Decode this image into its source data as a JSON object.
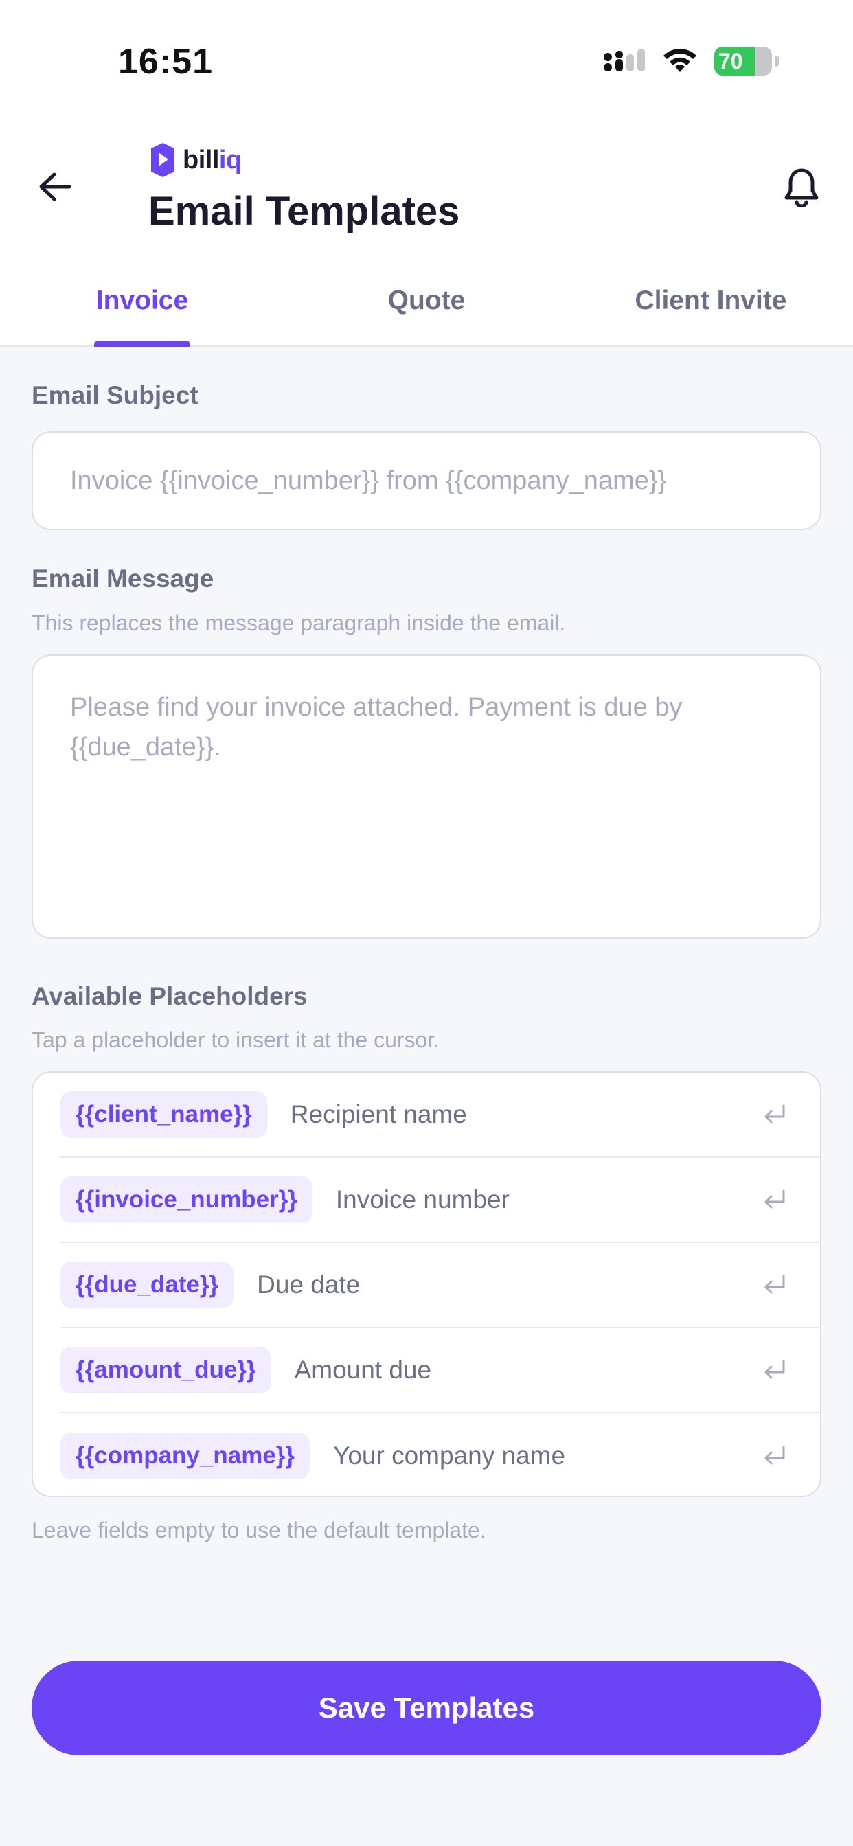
{
  "status_bar": {
    "time": "16:51",
    "battery_level": "70",
    "battery_fraction": 0.7,
    "icons": [
      "signal-icon",
      "wifi-icon",
      "battery-icon"
    ]
  },
  "header": {
    "brand_prefix": "bill",
    "brand_suffix": "iq",
    "title": "Email Templates",
    "back_icon": "arrow-left-icon",
    "bell_icon": "bell-icon"
  },
  "tabs": [
    {
      "label": "Invoice",
      "active": true
    },
    {
      "label": "Quote",
      "active": false
    },
    {
      "label": "Client Invite",
      "active": false
    }
  ],
  "subject": {
    "label": "Email Subject",
    "value": "",
    "placeholder": "Invoice {{invoice_number}} from {{company_name}}"
  },
  "message": {
    "label": "Email Message",
    "hint": "This replaces the message paragraph inside the email.",
    "value": "",
    "placeholder": "Please find your invoice attached. Payment is due by {{due_date}}."
  },
  "placeholders": {
    "label": "Available Placeholders",
    "hint": "Tap a placeholder to insert it at the cursor.",
    "items": [
      {
        "token": "{{client_name}}",
        "description": "Recipient name"
      },
      {
        "token": "{{invoice_number}}",
        "description": "Invoice number"
      },
      {
        "token": "{{due_date}}",
        "description": "Due date"
      },
      {
        "token": "{{amount_due}}",
        "description": "Amount due"
      },
      {
        "token": "{{company_name}}",
        "description": "Your company name"
      }
    ]
  },
  "footer_hint": "Leave fields empty to use the default template.",
  "save_button": {
    "label": "Save Templates"
  },
  "colors": {
    "accent": "#6b45f5",
    "chip_bg": "#f1edff",
    "background": "#f6f7fb",
    "battery_green": "#34c759"
  }
}
